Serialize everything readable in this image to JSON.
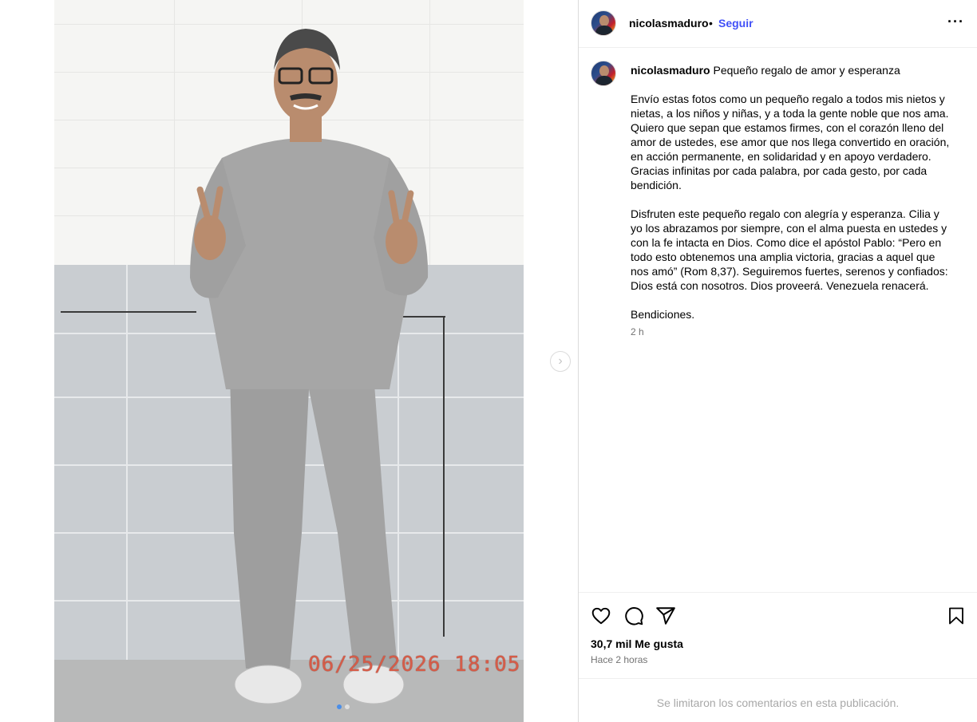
{
  "post": {
    "username": "nicolasmaduro",
    "bullet": "•",
    "follow_label": "Seguir",
    "more_label": "···",
    "caption_intro": "Pequeño regalo de amor y esperanza",
    "caption_body": "Envío estas fotos como un pequeño regalo a todos mis nietos y nietas, a los niños y niñas, y a toda la gente noble que nos ama. Quiero que sepan que estamos firmes, con el corazón lleno del amor de ustedes, ese amor que nos llega convertido en oración, en acción permanente, en solidaridad y en apoyo verdadero. Gracias infinitas por cada palabra, por cada gesto, por cada bendición.\n\nDisfruten este pequeño regalo con alegría y esperanza. Cilia y yo los abrazamos por siempre, con el alma puesta en ustedes y con la fe intacta en Dios. Como dice el apóstol Pablo: “Pero en todo esto obtenemos una amplia victoria, gracias a aquel que nos amó” (Rom 8,37). Seguiremos fuertes, serenos y confiados: Dios está con nosotros. Dios proveerá. Venezuela renacerá.\n\nBendiciones.",
    "caption_time": "2 h",
    "likes": "30,7 mil Me gusta",
    "posted_ago": "Hace 2 horas",
    "comments_limited": "Se limitaron los comentarios en esta publicación."
  },
  "media": {
    "timestamp": "06/25/2026 18:05",
    "slides_total": 2,
    "slide_active": 1,
    "next_icon": "chevron-right-icon"
  },
  "icons": {
    "like": "heart-icon",
    "comment": "comment-icon",
    "share": "paper-plane-icon",
    "save": "bookmark-icon"
  },
  "colors": {
    "follow": "#4150f7",
    "secondary_text": "#737373",
    "muted_text": "#a8a8a8",
    "timestamp": "#d65c48",
    "active_dot": "#4a8ee8"
  }
}
